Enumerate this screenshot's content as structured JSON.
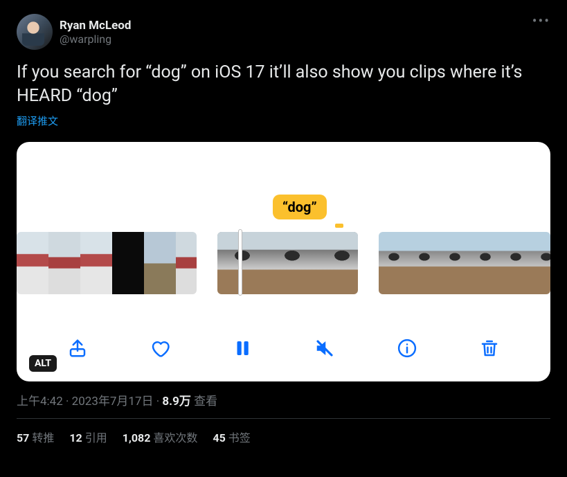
{
  "author": {
    "display_name": "Ryan McLeod",
    "handle": "@warpling"
  },
  "tweet_text": "If you search for “dog” on iOS 17 it’ll also show you clips where it’s HEARD “dog”",
  "translate_label": "翻译推文",
  "media": {
    "bubble_text": "“dog”",
    "alt_badge": "ALT",
    "toolbar_icons": [
      "share",
      "heart",
      "pause",
      "mute",
      "info",
      "trash"
    ]
  },
  "meta": {
    "time": "上午4:42",
    "date": "2023年7月17日",
    "views_number": "8.9万",
    "views_label": "查看",
    "separator": " · "
  },
  "stats": {
    "retweets": {
      "count": "57",
      "label": "转推"
    },
    "quotes": {
      "count": "12",
      "label": "引用"
    },
    "likes": {
      "count": "1,082",
      "label": "喜欢次数"
    },
    "bookmarks": {
      "count": "45",
      "label": "书签"
    }
  }
}
